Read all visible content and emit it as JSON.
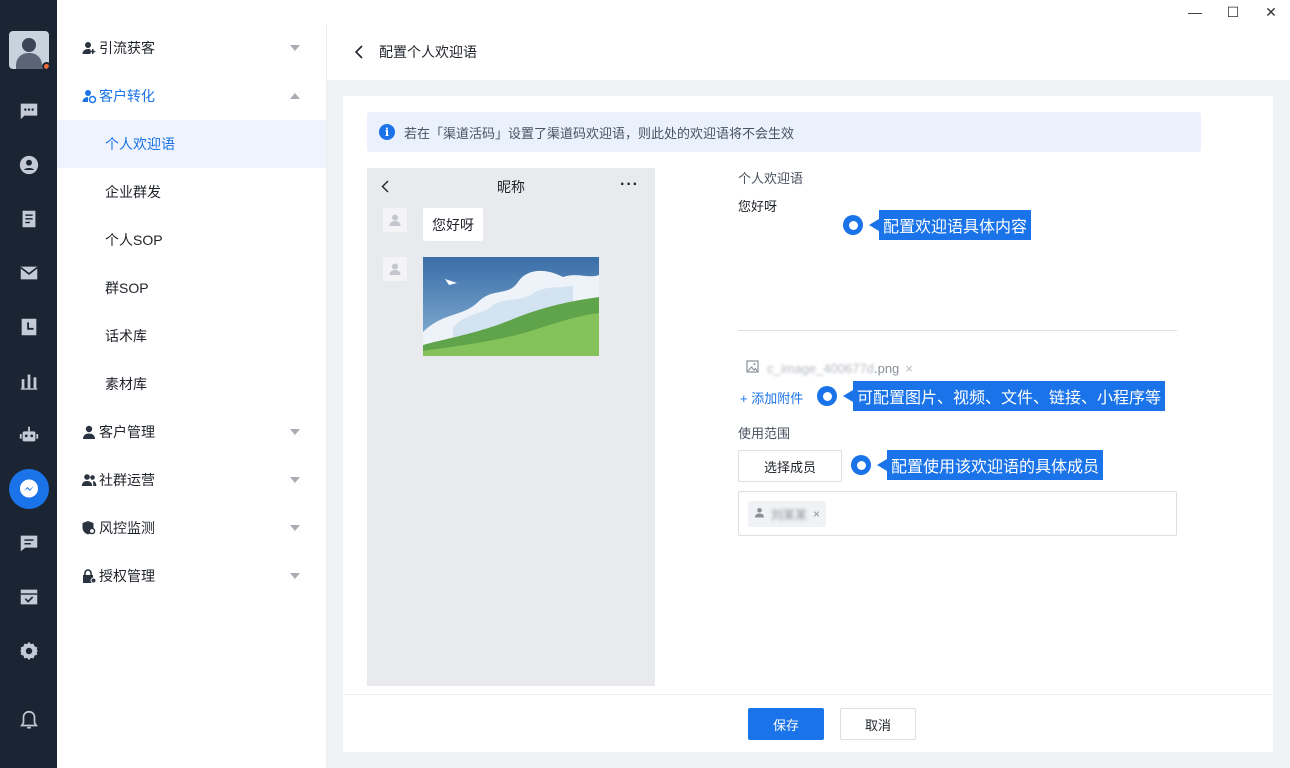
{
  "window": {
    "minimize": "—",
    "maximize": "☐",
    "close": "✕"
  },
  "sidebar": {
    "groups": [
      {
        "label": "引流获客"
      },
      {
        "label": "客户转化"
      },
      {
        "label": "客户管理"
      },
      {
        "label": "社群运营"
      },
      {
        "label": "风控监测"
      },
      {
        "label": "授权管理"
      }
    ],
    "sub_items": [
      "个人欢迎语",
      "企业群发",
      "个人SOP",
      "群SOP",
      "话术库",
      "素材库"
    ]
  },
  "page": {
    "title": "配置个人欢迎语",
    "notice": "若在「渠道活码」设置了渠道码欢迎语，则此处的欢迎语将不会生效"
  },
  "preview": {
    "nickname": "昵称",
    "more": "···",
    "message": "您好呀"
  },
  "form": {
    "welcome_label": "个人欢迎语",
    "welcome_text": "您好呀",
    "attachment_name": "c_image_400677d",
    "attachment_ext": ".png",
    "add_attachment": "+ 添加附件",
    "scope_label": "使用范围",
    "select_member": "选择成员",
    "member_tag": "刘某某"
  },
  "footer": {
    "save": "保存",
    "cancel": "取消"
  },
  "annotations": {
    "content": "配置欢迎语具体内容",
    "attachment": "可配置图片、视频、文件、链接、小程序等",
    "members": "配置使用该欢迎语的具体成员"
  },
  "colors": {
    "accent": "#1a73e8",
    "rail": "#1b2433",
    "notice_bg": "#eaf1fd"
  }
}
